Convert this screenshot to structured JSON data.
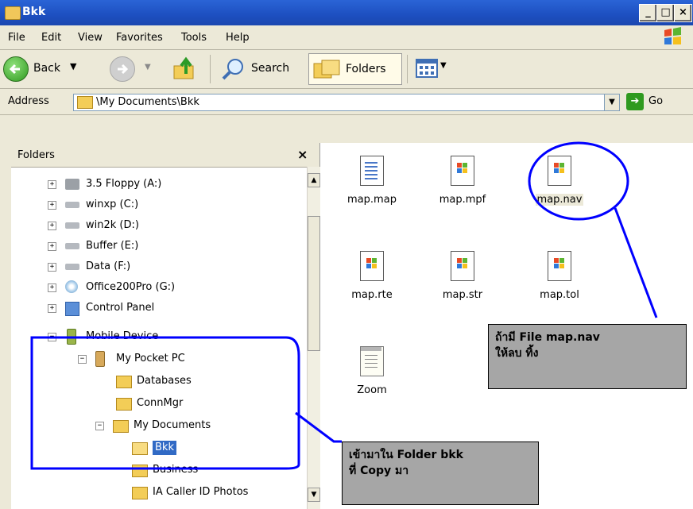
{
  "window": {
    "title": "Bkk",
    "min": "_",
    "max": "□",
    "close": "×"
  },
  "menu": [
    "File",
    "Edit",
    "View",
    "Favorites",
    "Tools",
    "Help"
  ],
  "toolbar": {
    "back": "Back",
    "search": "Search",
    "folders": "Folders"
  },
  "address": {
    "label": "Address",
    "value": "\\My Documents\\Bkk",
    "go": "Go"
  },
  "folders_pane": {
    "title": "Folders",
    "close": "×",
    "items": [
      "3.5 Floppy (A:)",
      "winxp (C:)",
      "win2k (D:)",
      "Buffer (E:)",
      "Data (F:)",
      "Office200Pro (G:)",
      "Control Panel",
      "Mobile Device",
      "My Pocket PC",
      "Databases",
      "ConnMgr",
      "My Documents",
      "Bkk",
      "Business",
      "IA Caller ID Photos"
    ]
  },
  "files": [
    "map.map",
    "map.mpf",
    "map.nav",
    "map.rte",
    "map.str",
    "map.tol",
    "Zoom"
  ],
  "callouts": {
    "nav_note_line1": "ถ้ามี File map.nav",
    "nav_note_line2": "ให้ลบ ทิ้ง",
    "folder_note_line1": "เข้ามาใน Folder bkk",
    "folder_note_line2": "ที่ Copy มา"
  },
  "colors": {
    "titlebar": "#2a64d6",
    "annotation": "#0000ff",
    "callout_bg": "#a6a6a6",
    "selected": "#316ac5"
  }
}
